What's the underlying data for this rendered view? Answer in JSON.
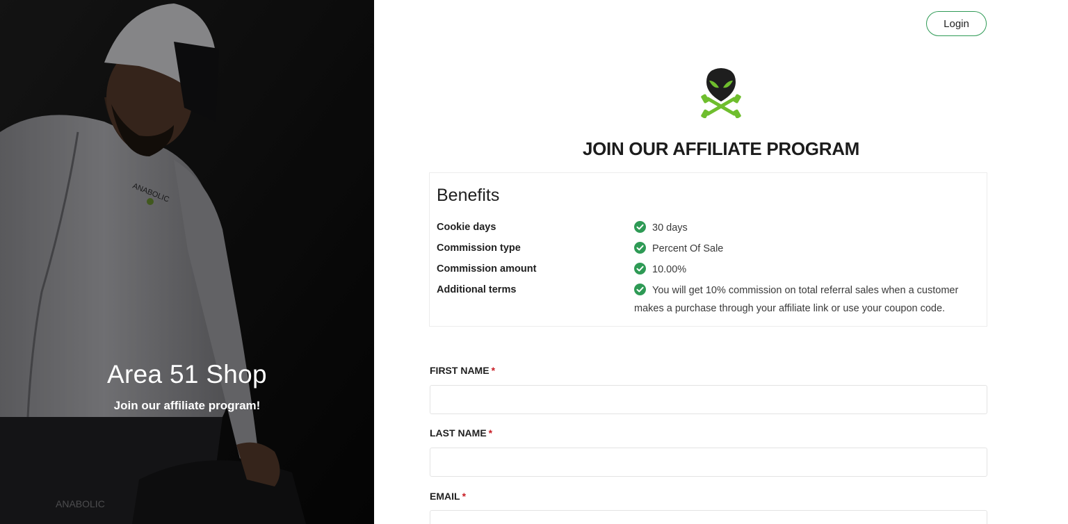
{
  "hero": {
    "title": "Area 51 Shop",
    "subtitle": "Join our affiliate program!",
    "jacket_brand": "ANABOLIC",
    "cap_brand": "ANABOLIC"
  },
  "header": {
    "login_label": "Login"
  },
  "page": {
    "title": "JOIN OUR AFFILIATE PROGRAM"
  },
  "benefits": {
    "title": "Benefits",
    "rows": [
      {
        "label": "Cookie days",
        "value": "30 days"
      },
      {
        "label": "Commission type",
        "value": "Percent Of Sale"
      },
      {
        "label": "Commission amount",
        "value": "10.00%"
      },
      {
        "label": "Additional terms",
        "value": "You will get 10% commission on total referral sales when a customer makes a purchase through your affiliate link or use your coupon code."
      }
    ]
  },
  "form": {
    "required_mark": "*",
    "first_name": {
      "label": "FIRST NAME",
      "value": "",
      "placeholder": ""
    },
    "last_name": {
      "label": "LAST NAME",
      "value": "",
      "placeholder": ""
    },
    "email": {
      "label": "EMAIL",
      "value": "",
      "placeholder": ""
    }
  },
  "colors": {
    "accent_green": "#2e9a55",
    "required_red": "#c81d25",
    "hero_background": "#0c0c0c"
  },
  "icons": {
    "check": "check-circle-icon",
    "logo": "alien-skull-dumbbells-logo"
  }
}
